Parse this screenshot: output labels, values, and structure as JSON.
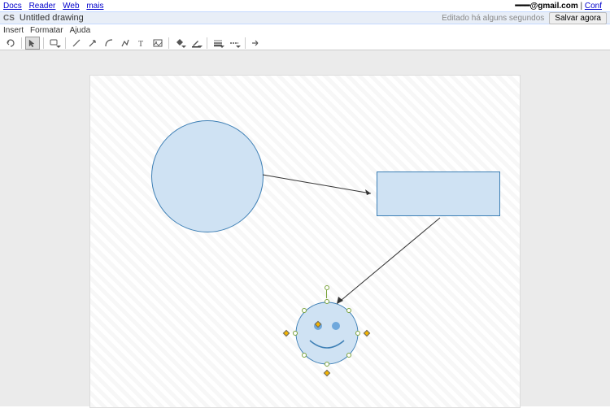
{
  "topbar": {
    "links": [
      "Docs",
      "Reader",
      "Web",
      "mais"
    ],
    "email": "━━━@gmail.com",
    "config": "Conf"
  },
  "header": {
    "logo": "CS",
    "title": "Untitled drawing",
    "status": "Editado há alguns segundos",
    "save_btn": "Salvar agora"
  },
  "menus": [
    "Insert",
    "Formatar",
    "Ajuda"
  ],
  "shapes": {
    "circle": {
      "fill": "#cfe2f3",
      "stroke": "#3d7fb5"
    },
    "rect": {
      "fill": "#cfe2f3",
      "stroke": "#3d7fb5"
    },
    "smiley": {
      "fill": "#cfe2f3",
      "stroke": "#3d7fb5",
      "selected": true
    }
  }
}
